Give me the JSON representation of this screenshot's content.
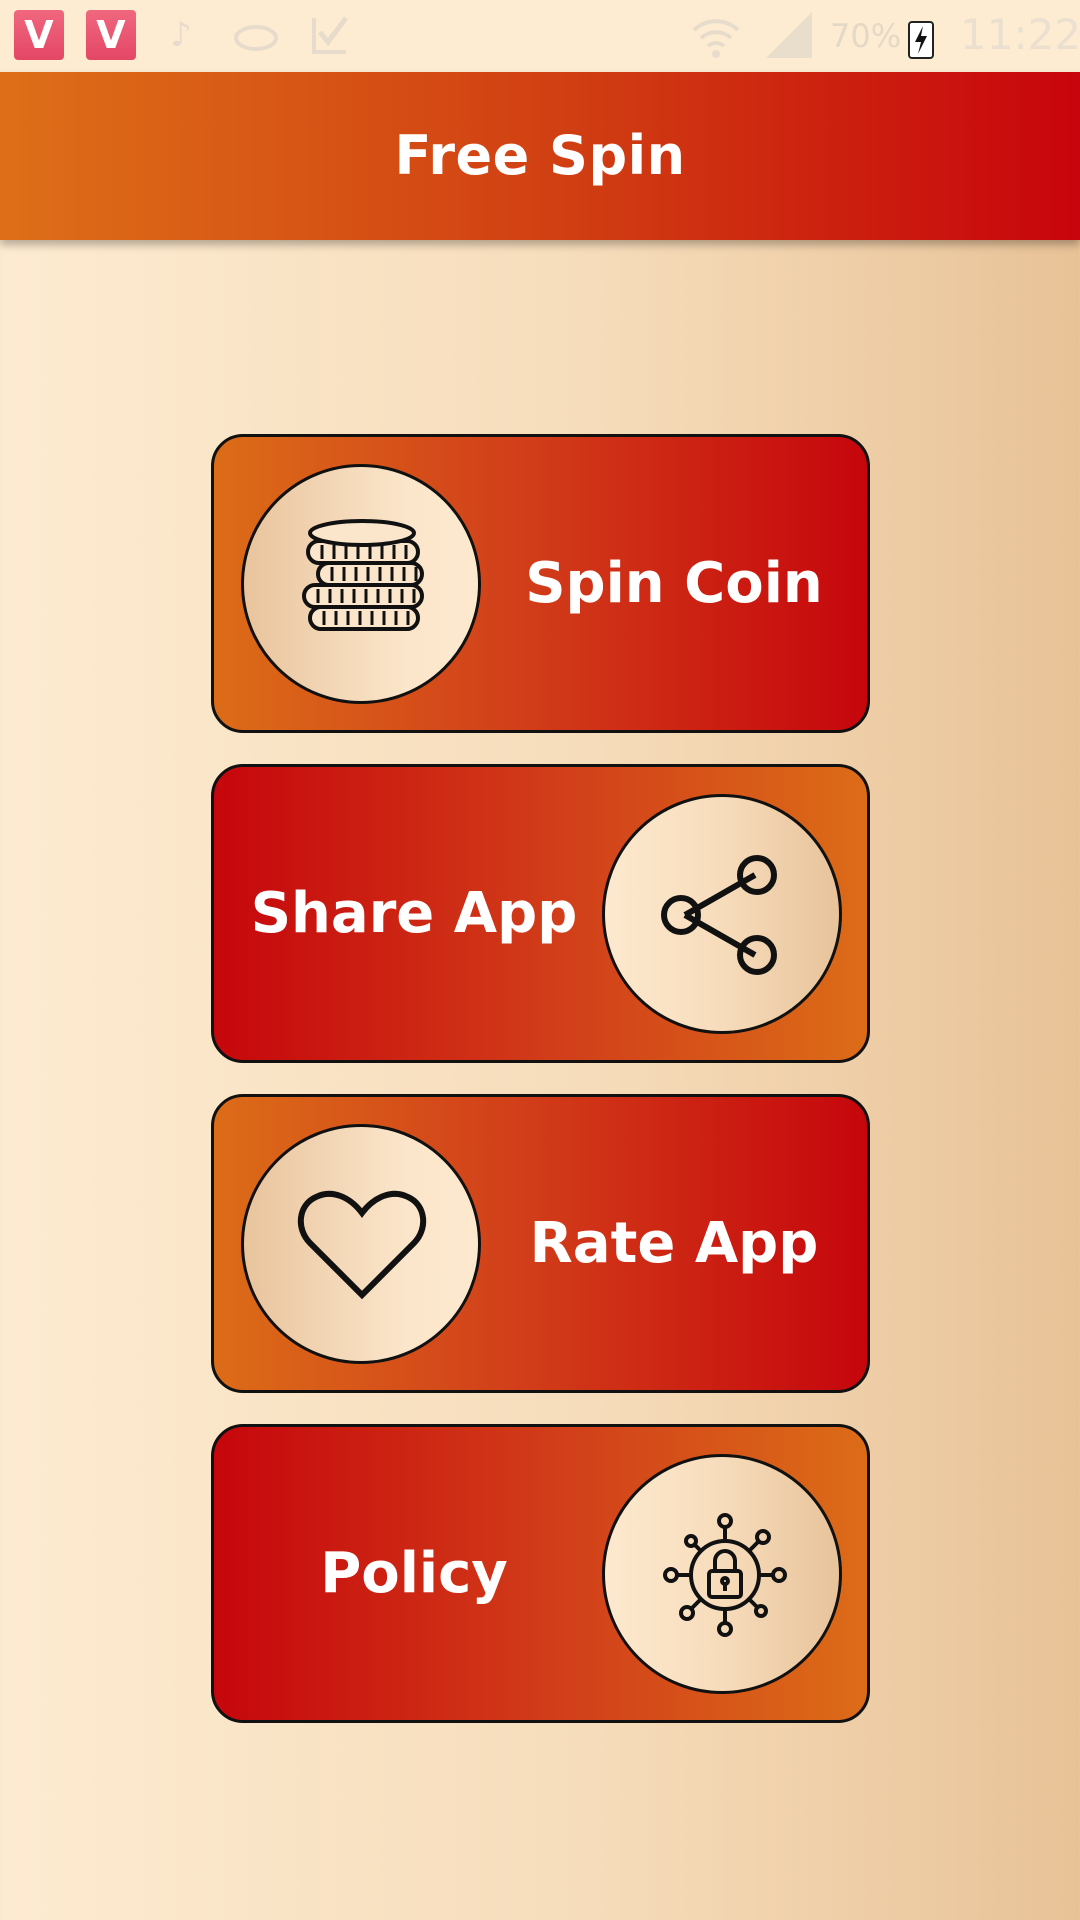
{
  "status_bar": {
    "notification_icons": [
      "vidmate-icon",
      "vidmate-icon",
      "tiktok-icon",
      "sync-icon",
      "check-icon"
    ],
    "battery_text": "70%",
    "time": "11:22",
    "icons": [
      "wifi-icon",
      "cell-signal-icon",
      "battery-charging-icon"
    ]
  },
  "app_bar": {
    "title": "Free Spin"
  },
  "menu": [
    {
      "label": "Spin Coin",
      "icon": "coins-icon"
    },
    {
      "label": "Share App",
      "icon": "share-icon"
    },
    {
      "label": "Rate App",
      "icon": "heart-icon"
    },
    {
      "label": "Policy",
      "icon": "privacy-lock-icon"
    }
  ],
  "colors": {
    "accent_start": "#dc6c18",
    "accent_end": "#c6060c",
    "background": "#fdebd1"
  }
}
